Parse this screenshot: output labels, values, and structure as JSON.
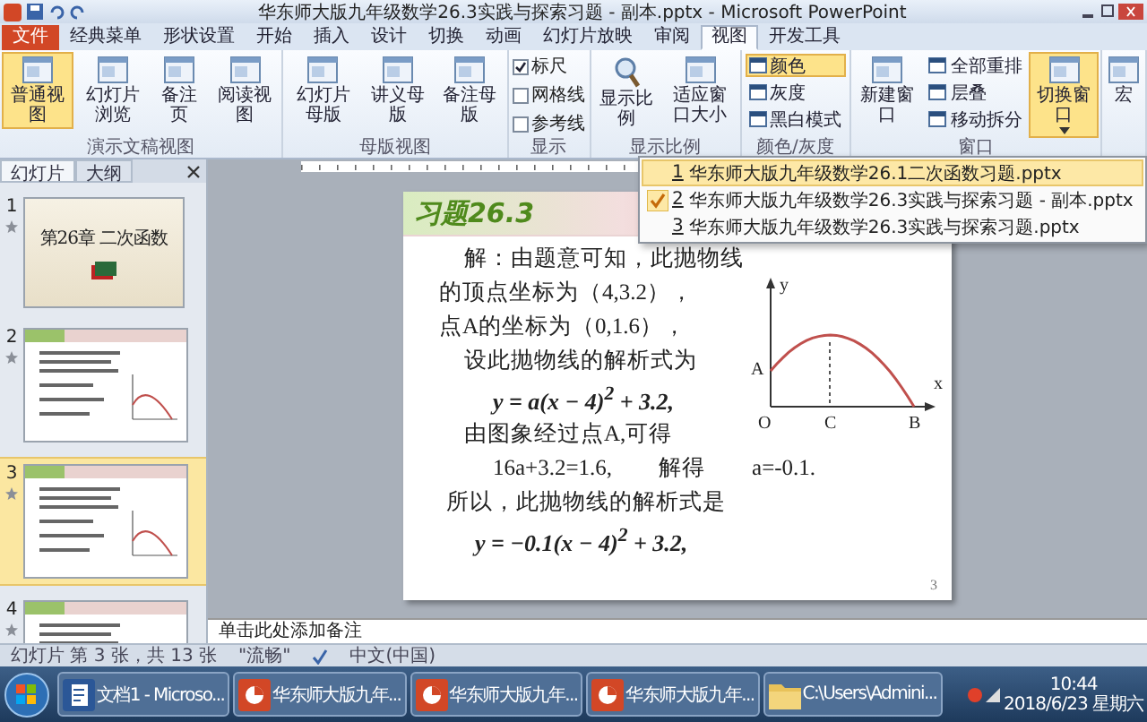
{
  "window": {
    "title": "华东师大版九年级数学26.3实践与探索习题 - 副本.pptx - Microsoft PowerPoint"
  },
  "tabs": [
    {
      "label": "文件",
      "kind": "file",
      "selected": false
    },
    {
      "label": "经典菜单",
      "kind": "normal",
      "selected": false
    },
    {
      "label": "形状设置",
      "kind": "normal",
      "selected": false
    },
    {
      "label": "开始",
      "kind": "normal",
      "selected": false
    },
    {
      "label": "插入",
      "kind": "normal",
      "selected": false
    },
    {
      "label": "设计",
      "kind": "normal",
      "selected": false
    },
    {
      "label": "切换",
      "kind": "normal",
      "selected": false
    },
    {
      "label": "动画",
      "kind": "normal",
      "selected": false
    },
    {
      "label": "幻灯片放映",
      "kind": "normal",
      "selected": false
    },
    {
      "label": "审阅",
      "kind": "normal",
      "selected": false
    },
    {
      "label": "视图",
      "kind": "normal",
      "selected": true
    },
    {
      "label": "开发工具",
      "kind": "normal",
      "selected": false
    }
  ],
  "ribbon": {
    "groups": [
      {
        "label": "演示文稿视图",
        "items": [
          {
            "kind": "large",
            "label": "普通视图",
            "selected": true
          },
          {
            "kind": "large",
            "label": "幻灯片浏览",
            "selected": false
          },
          {
            "kind": "large",
            "label": "备注页",
            "selected": false
          },
          {
            "kind": "large",
            "label": "阅读视图",
            "selected": false
          }
        ]
      },
      {
        "label": "母版视图",
        "items": [
          {
            "kind": "large",
            "label": "幻灯片母版",
            "selected": false
          },
          {
            "kind": "large",
            "label": "讲义母版",
            "selected": false
          },
          {
            "kind": "large",
            "label": "备注母版",
            "selected": false
          }
        ]
      },
      {
        "label": "显示",
        "items": [
          {
            "kind": "check",
            "label": "标尺",
            "checked": true
          },
          {
            "kind": "check",
            "label": "网格线",
            "checked": false
          },
          {
            "kind": "check",
            "label": "参考线",
            "checked": false
          }
        ]
      },
      {
        "label": "显示比例",
        "items": [
          {
            "kind": "zoom",
            "label": "显示比例",
            "selected": false
          },
          {
            "kind": "large",
            "label": "适应窗口大小",
            "selected": false
          }
        ]
      },
      {
        "label": "颜色/灰度",
        "items": [
          {
            "kind": "small",
            "label": "颜色",
            "selected": true
          },
          {
            "kind": "small",
            "label": "灰度",
            "selected": false
          },
          {
            "kind": "small",
            "label": "黑白模式",
            "selected": false
          }
        ]
      },
      {
        "label": "窗口",
        "items": [
          {
            "kind": "large",
            "label": "新建窗口",
            "selected": false
          },
          {
            "kind": "small",
            "label": "全部重排",
            "selected": false
          },
          {
            "kind": "small",
            "label": "层叠",
            "selected": false
          },
          {
            "kind": "small",
            "label": "移动拆分",
            "selected": false
          },
          {
            "kind": "large",
            "label": "切换窗口",
            "selected": true
          }
        ]
      },
      {
        "items": [
          {
            "kind": "large",
            "label": "宏",
            "selected": false
          }
        ]
      }
    ]
  },
  "window_menu": {
    "items": [
      {
        "number": "1",
        "text": "华东师大版九年级数学26.1二次函数习题.pptx",
        "selected": true,
        "checked": false
      },
      {
        "number": "2",
        "text": "华东师大版九年级数学26.3实践与探索习题 - 副本.pptx",
        "selected": false,
        "checked": true
      },
      {
        "number": "3",
        "text": "华东师大版九年级数学26.3实践与探索习题.pptx",
        "selected": false,
        "checked": false
      }
    ]
  },
  "side_panel": {
    "tabs": [
      {
        "label": "幻灯片",
        "selected": true
      },
      {
        "label": "大纲",
        "selected": false
      }
    ],
    "slides": [
      {
        "number": "1",
        "kind": "title",
        "title": "第26章 二次函数",
        "selected": false
      },
      {
        "number": "2",
        "kind": "content",
        "selected": false
      },
      {
        "number": "3",
        "kind": "content",
        "selected": true
      },
      {
        "number": "4",
        "kind": "content",
        "selected": false
      }
    ]
  },
  "slide": {
    "title": "习题26.3",
    "text_beside_graph": [
      {
        "kind": "indent",
        "text": "解：由题意可知，此抛物线"
      },
      {
        "kind": "plain",
        "text": "的顶点坐标为（4,3.2），"
      },
      {
        "kind": "plain",
        "text": "点A的坐标为（0,1.6），"
      },
      {
        "kind": "indent",
        "text": "设此抛物线的解析式为"
      },
      {
        "kind": "formula",
        "text": "y = a(x − 4)$^{2}$ + 3.2,"
      },
      {
        "kind": "indent",
        "text": "由图象经过点A,可得"
      }
    ],
    "text_below_graph": [
      {
        "kind": "pair",
        "parts": [
          "16a+3.2=1.6,",
          "解得",
          "a=-0.1."
        ]
      },
      {
        "kind": "indent",
        "text": "所以，此抛物线的解析式是"
      },
      {
        "kind": "formula",
        "text": "y = −0.1(x − 4)$^{2}$ + 3.2,"
      }
    ],
    "graph": {
      "labels": [
        {
          "kind": "y-axis",
          "text": "y"
        },
        {
          "kind": "x-axis",
          "text": "x"
        },
        {
          "kind": "start",
          "text": "A"
        },
        {
          "kind": "origin",
          "text": "O"
        },
        {
          "kind": "vertex-foot",
          "text": "C"
        },
        {
          "kind": "root",
          "text": "B"
        }
      ]
    },
    "page_number": "3"
  },
  "notes": {
    "placeholder": "单击此处添加备注"
  },
  "status_bar": {
    "slide_info": "幻灯片 第 3 张，共 13 张",
    "theme": "\"流畅\"",
    "language": "中文(中国)"
  },
  "taskbar": {
    "items": [
      {
        "kind": "word",
        "label": "文档1 - Microso..."
      },
      {
        "kind": "powerpoint",
        "label": "华东师大版九年..."
      },
      {
        "kind": "powerpoint",
        "label": "华东师大版九年..."
      },
      {
        "kind": "powerpoint",
        "label": "华东师大版九年..."
      },
      {
        "kind": "folder",
        "label": "C:\\Users\\Admini..."
      }
    ],
    "time": "10:44",
    "date": "2018/6/23 星期六"
  }
}
